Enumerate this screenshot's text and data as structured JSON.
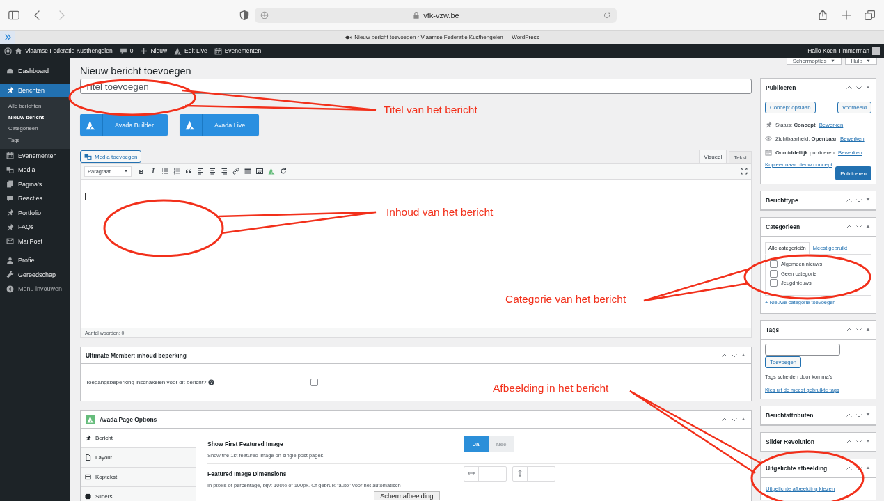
{
  "browser": {
    "url": "vfk-vzw.be",
    "tab_title": "Nieuw bericht toevoegen ‹ Vlaamse Federatie Kusthengelen — WordPress"
  },
  "admin_bar": {
    "items": [
      {
        "label": "Vlaamse Federatie Kusthengelen"
      },
      {
        "label": "0"
      },
      {
        "label": "Nieuw"
      },
      {
        "label": "Edit Live"
      },
      {
        "label": "Evenementen"
      }
    ],
    "greeting": "Hallo Koen Timmerman"
  },
  "sidebar": {
    "groups": [
      [
        {
          "label": "Dashboard",
          "selected": false
        }
      ],
      [
        {
          "label": "Berichten",
          "selected": true,
          "children": [
            {
              "label": "Alle berichten",
              "selected": false
            },
            {
              "label": "Nieuw bericht",
              "selected": true
            },
            {
              "label": "Categorieën",
              "selected": false
            },
            {
              "label": "Tags",
              "selected": false
            }
          ]
        },
        {
          "label": "Evenementen",
          "selected": false
        },
        {
          "label": "Media",
          "selected": false
        },
        {
          "label": "Pagina's",
          "selected": false
        },
        {
          "label": "Reacties",
          "selected": false
        },
        {
          "label": "Portfolio",
          "selected": false
        },
        {
          "label": "FAQs",
          "selected": false
        },
        {
          "label": "MailPoet",
          "selected": false
        }
      ],
      [
        {
          "label": "Profiel",
          "selected": false
        },
        {
          "label": "Gereedschap",
          "selected": false
        },
        {
          "label": "Menu invouwen",
          "selected": false
        }
      ]
    ]
  },
  "screen_buttons": [
    {
      "label": "Schermopties"
    },
    {
      "label": "Hulp"
    }
  ],
  "heading": "Nieuw bericht toevoegen",
  "title_field": {
    "placeholder": "Titel toevoegen"
  },
  "builder_buttons": [
    {
      "label": "Avada Builder"
    },
    {
      "label": "Avada Live"
    }
  ],
  "media_button": "Media toevoegen",
  "editor": {
    "tabs": [
      {
        "label": "Visueel",
        "selected": true
      },
      {
        "label": "Tekst",
        "selected": false
      }
    ],
    "format": "Paragraaf",
    "toolbar_glyphs": [
      "B",
      "I"
    ],
    "word_count": "Aantal woorden: 0"
  },
  "restriction_box": {
    "title": "Ultimate Member: inhoud beperking",
    "field": "Toegangsbeperking inschakelen voor dit bericht?",
    "checked": false
  },
  "page_options": {
    "title": "Avada Page Options",
    "tabs": [
      {
        "label": "Bericht",
        "selected": true
      },
      {
        "label": "Layout",
        "selected": false
      },
      {
        "label": "Koptekst",
        "selected": false
      },
      {
        "label": "Sliders",
        "selected": false
      }
    ],
    "options": [
      {
        "kind": "toggle",
        "title": "Show First Featured Image",
        "description": "Show the 1st featured image on single post pages.",
        "choices": [
          {
            "label": "Ja",
            "selected": true
          },
          {
            "label": "Nee",
            "selected": false
          }
        ]
      },
      {
        "kind": "dimensions",
        "title": "Featured Image Dimensions",
        "description": "In pixels of percentage, bijv: 100% of 100px. Of gebruik \"auto\" voor het automatisch"
      }
    ]
  },
  "side_boxes": [
    {
      "kind": "publish",
      "title": "Publiceren",
      "expanded": true,
      "save_button": "Concept opslaan",
      "preview_button": "Voorbeeld",
      "lines": [
        {
          "text": "Status: **Concept**",
          "link": "Bewerken"
        },
        {
          "text": "Zichtbaarheid: **Openbaar**",
          "link": "Bewerken"
        },
        {
          "text": "**Onmiddellijk** publiceren",
          "link": "Bewerken"
        }
      ],
      "copy_link": "Kopieer naar nieuw concept",
      "publish_button": "Publiceren"
    },
    {
      "title": "Berichttype",
      "expanded": false
    },
    {
      "kind": "categories",
      "title": "Categorieën",
      "expanded": true,
      "tabs": [
        {
          "label": "Alle categorieën",
          "selected": true
        },
        {
          "label": "Meest gebruikt",
          "selected": false
        }
      ],
      "items": [
        {
          "label": "Algemeen nieuws",
          "checked": false
        },
        {
          "label": "Geen categorie",
          "checked": false
        },
        {
          "label": "Jeugdnieuws",
          "checked": false
        }
      ],
      "add_link": "+ Nieuwe categorie toevoegen"
    },
    {
      "kind": "tags",
      "title": "Tags",
      "expanded": true,
      "button": "Toevoegen",
      "hint": "Tags scheiden door komma's",
      "link": "Kies uit de meest gebruikte tags"
    },
    {
      "title": "Berichtattributen",
      "expanded": false
    },
    {
      "title": "Slider Revolution",
      "expanded": false
    },
    {
      "kind": "featured",
      "title": "Uitgelichte afbeelding",
      "expanded": true,
      "link": "Uitgelichte afbeelding kiezen"
    }
  ],
  "annotations": [
    {
      "text": "Titel van het bericht"
    },
    {
      "text": "Inhoud van het bericht"
    },
    {
      "text": "Categorie van het bericht"
    },
    {
      "text": "Afbeelding in het bericht"
    }
  ],
  "tooltip": "Schermafbeelding"
}
